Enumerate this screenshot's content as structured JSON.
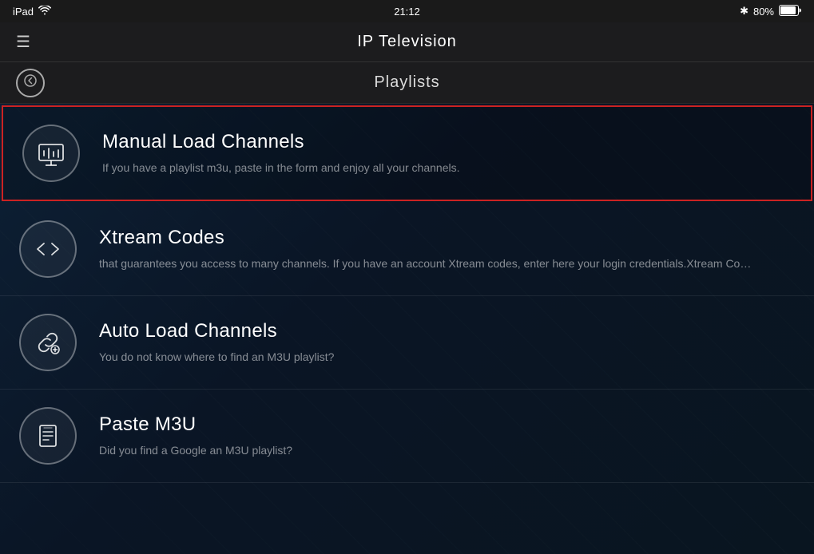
{
  "statusBar": {
    "device": "iPad",
    "wifi": "wifi",
    "time": "21:12",
    "bluetooth": "✱",
    "batteryPercent": "80%"
  },
  "navBar": {
    "menuIcon": "☰",
    "appTitle": "IP Television"
  },
  "playlistsHeader": {
    "backIcon": "←",
    "title": "Playlists"
  },
  "listItems": [
    {
      "id": "manual-load",
      "title": "Manual Load Channels",
      "description": "If you have a playlist m3u, paste in the form and enjoy all your channels.",
      "selected": true,
      "iconType": "tv"
    },
    {
      "id": "xtream-codes",
      "title": "Xtream Codes",
      "description": "that guarantees you access to many channels. If you have an account Xtream codes, enter here your login credentials.Xtream Codes is a",
      "selected": false,
      "iconType": "code"
    },
    {
      "id": "auto-load",
      "title": "Auto Load Channels",
      "description": "You do not know where to find an M3U playlist?",
      "selected": false,
      "iconType": "link"
    },
    {
      "id": "paste-m3u",
      "title": "Paste M3U",
      "description": "Did you find a Google an M3U playlist?",
      "selected": false,
      "iconType": "file"
    }
  ]
}
